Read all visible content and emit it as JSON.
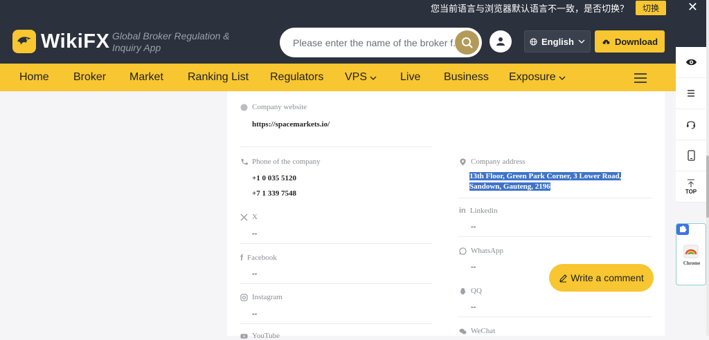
{
  "lang_prompt": {
    "text": "您当前语言与浏览器默认语言不一致，是否切换？",
    "switch_label": "切换",
    "close": "✕"
  },
  "brand": {
    "name": "WikiFX",
    "tagline": "Global Broker Regulation & Inquiry App"
  },
  "search": {
    "placeholder": "Please enter the name of the broker f..."
  },
  "header": {
    "language": "English",
    "download": "Download"
  },
  "nav": [
    {
      "label": "Home"
    },
    {
      "label": "Broker"
    },
    {
      "label": "Market"
    },
    {
      "label": "Ranking List"
    },
    {
      "label": "Regulators"
    },
    {
      "label": "VPS",
      "dropdown": true
    },
    {
      "label": "Live"
    },
    {
      "label": "Business"
    },
    {
      "label": "Exposure",
      "dropdown": true
    }
  ],
  "company": {
    "website_label": "Company website",
    "website": "https://spacemarkets.io/",
    "phone_label": "Phone of the company",
    "phone_1": "+1 0 035 5120",
    "phone_2": "+7 1 339 7548",
    "address_label": "Company address",
    "address": "13th Floor, Green Park Corner, 3 Lower Road, Sandown, Gauteng, 2196",
    "x_label": "X",
    "x_value": "--",
    "linkedin_label": "Linkedin",
    "linkedin_value": "--",
    "facebook_label": "Facebook",
    "facebook_value": "--",
    "whatsapp_label": "WhatsApp",
    "whatsapp_value": "--",
    "instagram_label": "Instagram",
    "instagram_value": "--",
    "qq_label": "QQ",
    "qq_value": "--",
    "wechat_label": "WeChat",
    "youtube_label": "YouTube"
  },
  "actions": {
    "write_comment": "Write a comment"
  },
  "sidebar": {
    "top_label": "TOP",
    "chrome_label": "Chrome"
  },
  "colors": {
    "accent": "#f7c630",
    "header_bg": "#2b313d",
    "selection": "#3e73c9"
  }
}
